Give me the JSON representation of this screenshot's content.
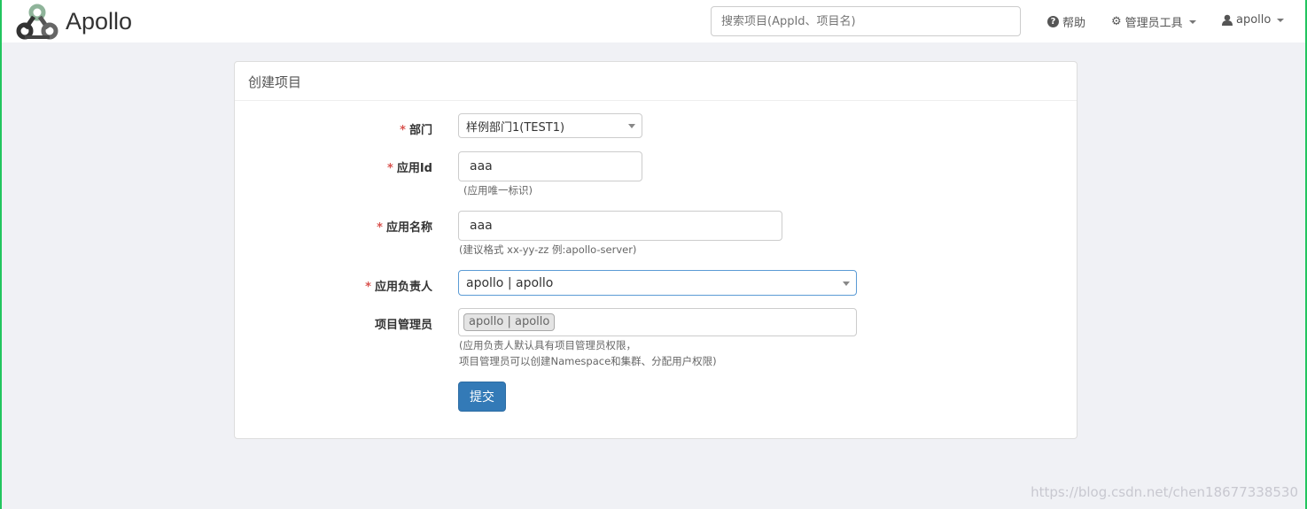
{
  "nav": {
    "brand": "Apollo",
    "search_placeholder": "搜索项目(AppId、项目名)",
    "help": "帮助",
    "admin_tools": "管理员工具",
    "user": "apollo"
  },
  "panel": {
    "title": "创建项目"
  },
  "form": {
    "required_mark": "*",
    "dept": {
      "label": "部门",
      "value": "样例部门1(TEST1)"
    },
    "appid": {
      "label": "应用Id",
      "value": "aaa",
      "help": "(应用唯一标识)"
    },
    "appname": {
      "label": "应用名称",
      "value": "aaa",
      "help": "(建议格式 xx-yy-zz 例:apollo-server)"
    },
    "owner": {
      "label": "应用负责人",
      "value": "apollo | apollo"
    },
    "admins": {
      "label": "项目管理员",
      "tags": [
        "apollo | apollo"
      ],
      "help1": "(应用负责人默认具有项目管理员权限，",
      "help2": "项目管理员可以创建Namespace和集群、分配用户权限)"
    },
    "submit": "提交"
  },
  "watermark": "https://blog.csdn.net/chen18677338530"
}
